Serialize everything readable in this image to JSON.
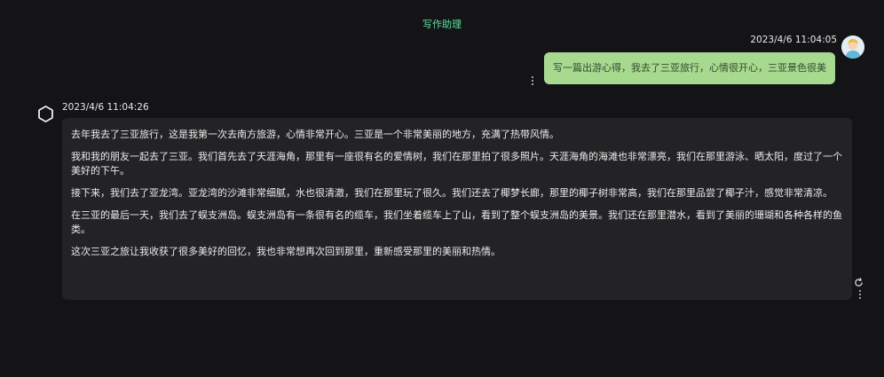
{
  "header": {
    "title": "写作助理"
  },
  "user_message": {
    "timestamp": "2023/4/6 11:04:05",
    "text": "写一篇出游心得，我去了三亚旅行，心情很开心，三亚景色很美"
  },
  "bot_message": {
    "timestamp": "2023/4/6 11:04:26",
    "paragraphs": [
      "去年我去了三亚旅行，这是我第一次去南方旅游，心情非常开心。三亚是一个非常美丽的地方，充满了热带风情。",
      "我和我的朋友一起去了三亚。我们首先去了天涯海角，那里有一座很有名的爱情树，我们在那里拍了很多照片。天涯海角的海滩也非常漂亮，我们在那里游泳、晒太阳，度过了一个美好的下午。",
      "接下来，我们去了亚龙湾。亚龙湾的沙滩非常细腻，水也很清澈，我们在那里玩了很久。我们还去了椰梦长廊，那里的椰子树非常高，我们在那里品尝了椰子汁，感觉非常清凉。",
      "在三亚的最后一天，我们去了蜈支洲岛。蜈支洲岛有一条很有名的缆车，我们坐着缆车上了山，看到了整个蜈支洲岛的美景。我们还在那里潜水，看到了美丽的珊瑚和各种各样的鱼类。",
      "这次三亚之旅让我收获了很多美好的回忆，我也非常想再次回到那里，重新感受那里的美丽和热情。"
    ]
  },
  "icons": {
    "user_avatar": "user-avatar-icon",
    "bot_avatar": "openai-logo-icon",
    "more": "more-vertical-icon",
    "regenerate": "refresh-icon"
  },
  "colors": {
    "background": "#141417",
    "title": "#5ee0a2",
    "user_bubble": "#a7d98f",
    "bot_bubble": "#232326"
  }
}
